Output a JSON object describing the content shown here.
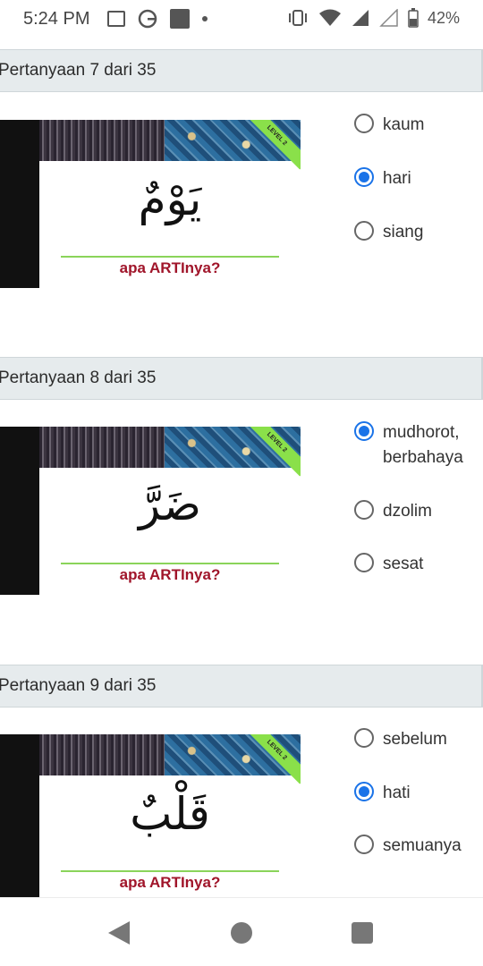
{
  "status_bar": {
    "time": "5:24 PM",
    "battery": "42%"
  },
  "questions": [
    {
      "header": "Pertanyaan 7 dari 35",
      "card": {
        "level": "LEVEL 2",
        "word": "يَوْمٌ",
        "caption": "apa ARTInya?"
      },
      "options": [
        {
          "label": "kaum",
          "checked": false
        },
        {
          "label": "hari",
          "checked": true
        },
        {
          "label": "siang",
          "checked": false
        }
      ]
    },
    {
      "header": "Pertanyaan 8 dari 35",
      "card": {
        "level": "LEVEL 2",
        "word": "ضَرَّ",
        "caption": "apa ARTInya?"
      },
      "options": [
        {
          "label": "mudhorot, berbahaya",
          "checked": true
        },
        {
          "label": "dzolim",
          "checked": false
        },
        {
          "label": "sesat",
          "checked": false
        }
      ]
    },
    {
      "header": "Pertanyaan 9 dari 35",
      "card": {
        "level": "LEVEL 2",
        "word": "قَلْبٌ",
        "caption": "apa ARTInya?"
      },
      "options": [
        {
          "label": "sebelum",
          "checked": false
        },
        {
          "label": "hati",
          "checked": true
        },
        {
          "label": "semuanya",
          "checked": false
        }
      ]
    }
  ]
}
